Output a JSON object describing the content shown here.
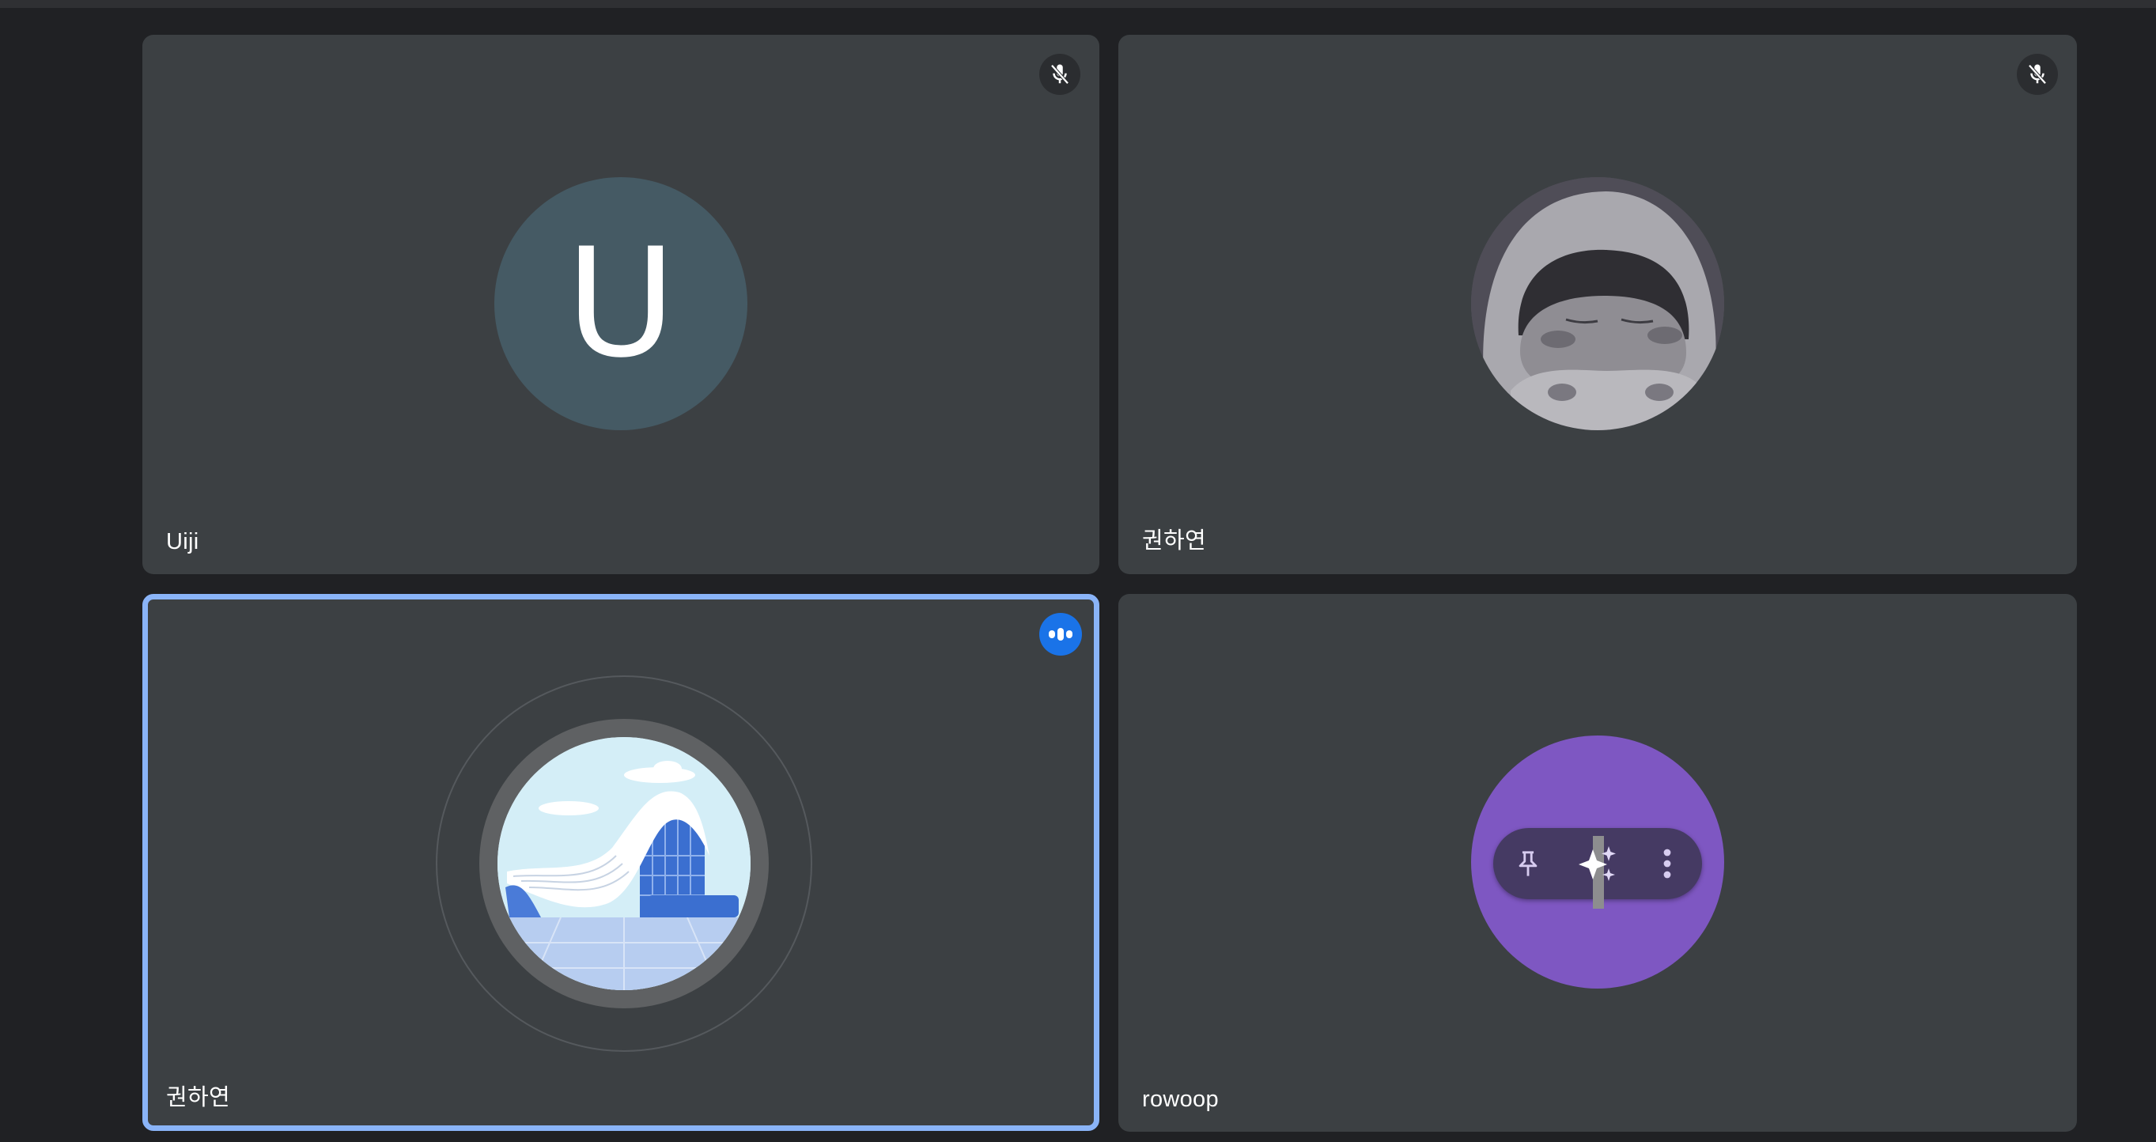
{
  "participants": [
    {
      "name": "Uiji",
      "avatar_letter": "U",
      "avatar_color": "#455a64",
      "muted": true,
      "speaking": false
    },
    {
      "name": "권하연",
      "avatar_type": "illustration-hooded-character",
      "muted": true,
      "speaking": false
    },
    {
      "name": "권하연",
      "avatar_type": "illustration-curved-building",
      "muted": false,
      "speaking": true
    },
    {
      "name": "rowoop",
      "avatar_color": "#7e57c2",
      "muted": false,
      "speaking": false
    }
  ],
  "hover_toolbar": {
    "pin_icon": "pin-icon",
    "effects_icon": "sparkle-icon",
    "more_icon": "more-vert-icon"
  },
  "colors": {
    "background": "#202124",
    "tile": "#3c4043",
    "active_border": "#8ab4f8",
    "speaking_badge": "#1a73e8"
  }
}
